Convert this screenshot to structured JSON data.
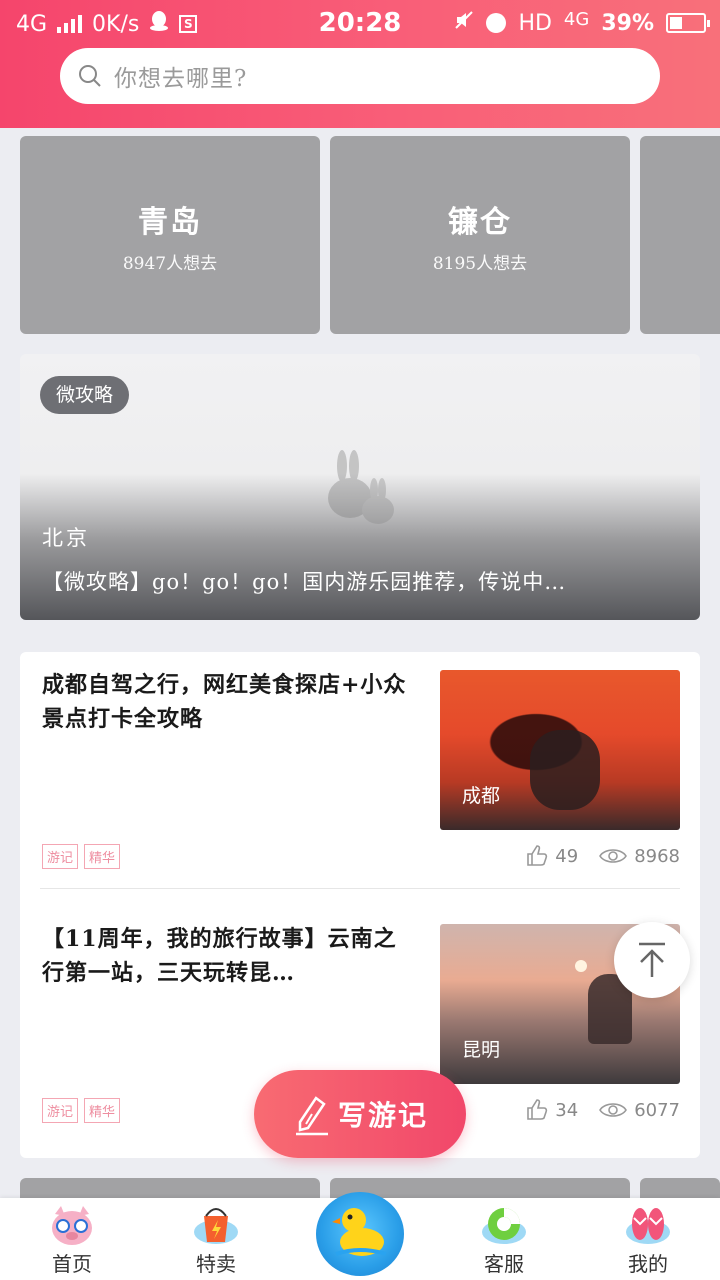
{
  "status_bar": {
    "network": "4G",
    "speed": "0K/s",
    "time": "20:28",
    "hd": "HD",
    "network_right": "4G",
    "battery": "39%",
    "battery_level": 0.39
  },
  "search": {
    "placeholder": "你想去哪里?"
  },
  "destinations": [
    {
      "city": "青岛",
      "count": "8947人想去"
    },
    {
      "city": "镰仓",
      "count": "8195人想去"
    }
  ],
  "guide": {
    "tag": "微攻略",
    "location": "北京",
    "title": "【微攻略】go！go！go！国内游乐园推荐，传说中…"
  },
  "travelogues": [
    {
      "title": "成都自驾之行，网红美食探店+小众景点打卡全攻略",
      "location": "成都",
      "tags": [
        "游记",
        "精华"
      ],
      "likes": "49",
      "views": "8968"
    },
    {
      "title": "【11周年，我的旅行故事】云南之行第一站，三天玩转昆…",
      "location": "昆明",
      "tags": [
        "游记",
        "精华"
      ],
      "likes": "34",
      "views": "6077"
    }
  ],
  "write_button": {
    "label": "写游记"
  },
  "tabbar": {
    "home": "首页",
    "sale": "特卖",
    "service": "客服",
    "mine": "我的"
  },
  "colors": {
    "header_gradient_start": "#f5456c",
    "header_gradient_end": "#f8707a",
    "accent": "#f1476a",
    "tag_pink": "#ee8ea0"
  }
}
